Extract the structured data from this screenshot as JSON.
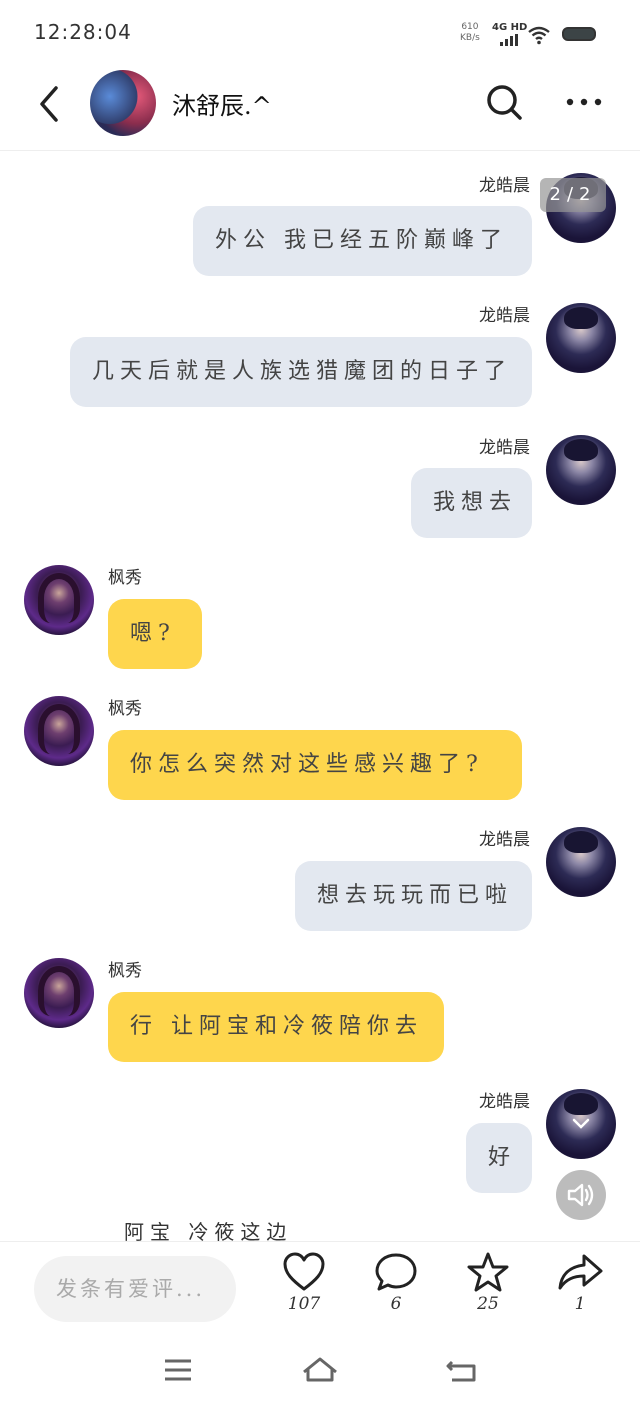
{
  "status": {
    "time": "12:28:04",
    "speed_value": "610",
    "speed_unit": "KB/s",
    "network": "4G HD"
  },
  "header": {
    "title": "沐舒辰.^"
  },
  "counter": "2/2",
  "messages": [
    {
      "sender": "龙皓晨",
      "text": "外公 我已经五阶巅峰了",
      "side": "right"
    },
    {
      "sender": "龙皓晨",
      "text": "几天后就是人族选猎魔团的日子了",
      "side": "right"
    },
    {
      "sender": "龙皓晨",
      "text": "我想去",
      "side": "right"
    },
    {
      "sender": "枫秀",
      "text": "嗯?",
      "side": "left"
    },
    {
      "sender": "枫秀",
      "text": "你怎么突然对这些感兴趣了?",
      "side": "left"
    },
    {
      "sender": "龙皓晨",
      "text": "想去玩玩而已啦",
      "side": "right"
    },
    {
      "sender": "枫秀",
      "text": "行 让阿宝和冷筱陪你去",
      "side": "left"
    },
    {
      "sender": "龙皓晨",
      "text": "好",
      "side": "right"
    }
  ],
  "overflow_text": "阿宝 冷筱这边",
  "bottombar": {
    "comment_placeholder": "发条有爱评...",
    "like_count": "107",
    "comment_count": "6",
    "star_count": "25",
    "share_count": "1"
  },
  "icons": [
    "back-icon",
    "search-icon",
    "more-icon",
    "heart-icon",
    "comment-icon",
    "star-icon",
    "share-icon",
    "speaker-icon",
    "menu-icon",
    "home-icon",
    "return-icon"
  ]
}
